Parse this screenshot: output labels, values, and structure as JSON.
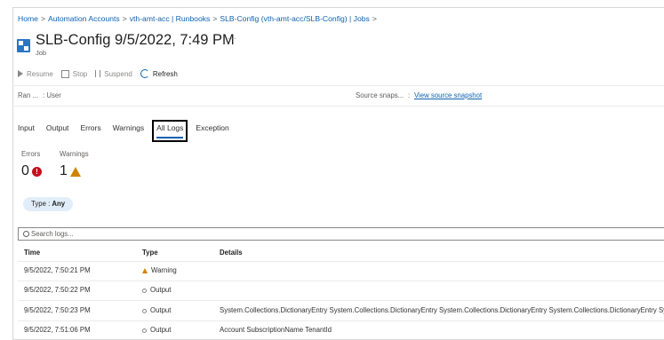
{
  "breadcrumb": [
    "Home",
    "Automation Accounts",
    "vth-amt-acc | Runbooks",
    "SLB-Config (vth-amt-acc/SLB-Config) | Jobs"
  ],
  "breadcrumb_sep": ">",
  "header": {
    "title": "SLB-Config 9/5/2022, 7:49 PM",
    "subtitle": "Job",
    "more": "···"
  },
  "toolbar": {
    "resume": "Resume",
    "stop": "Stop",
    "suspend": "Suspend",
    "refresh": "Refresh"
  },
  "essentials": {
    "ran_by_label": "Ran ...",
    "ran_by_value": ": User",
    "source_label": "Source snaps...",
    "source_sep": ":",
    "source_link": "View source snapshot"
  },
  "tabs": [
    "Input",
    "Output",
    "Errors",
    "Warnings",
    "All Logs",
    "Exception"
  ],
  "active_tab": "All Logs",
  "counts": {
    "errors_label": "Errors",
    "errors_value": "0",
    "warnings_label": "Warnings",
    "warnings_value": "1"
  },
  "filter": {
    "label": "Type : ",
    "value": "Any"
  },
  "search": {
    "placeholder": "Search logs..."
  },
  "table": {
    "columns": [
      "Time",
      "Type",
      "Details"
    ],
    "rows": [
      {
        "time": "9/5/2022, 7:50:21 PM",
        "type": "Warning",
        "details": ""
      },
      {
        "time": "9/5/2022, 7:50:22 PM",
        "type": "Output",
        "details": ""
      },
      {
        "time": "9/5/2022, 7:50:23 PM",
        "type": "Output",
        "details": "System.Collections.DictionaryEntry System.Collections.DictionaryEntry System.Collections.DictionaryEntry System.Collections.DictionaryEntry Syste"
      },
      {
        "time": "9/5/2022, 7:51:06 PM",
        "type": "Output",
        "details": "Account SubscriptionName TenantId"
      }
    ]
  },
  "colors": {
    "link": "#0f62b0",
    "error": "#c50f1f",
    "warning": "#d18300",
    "accent": "#0f62b0"
  }
}
